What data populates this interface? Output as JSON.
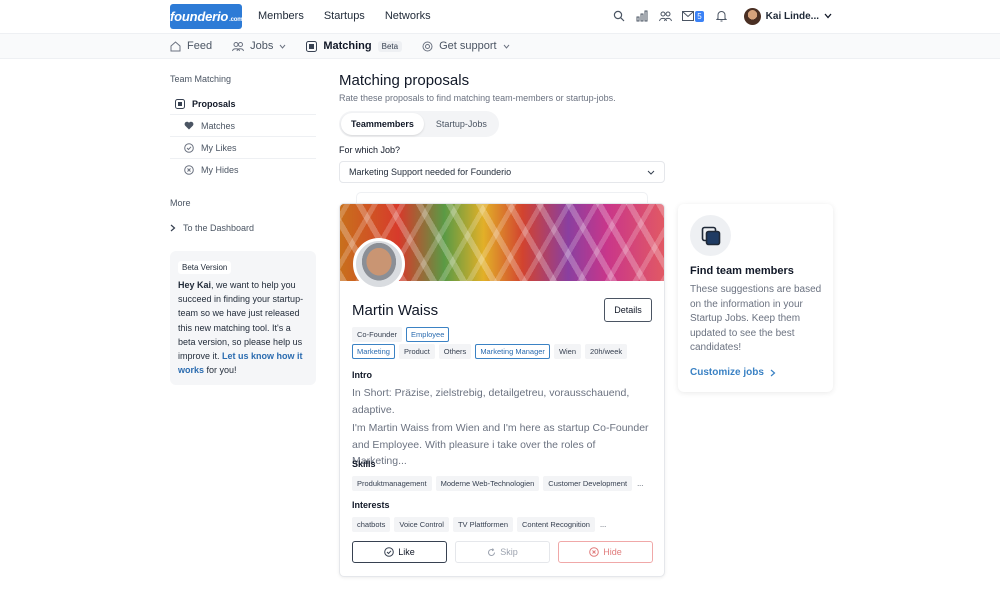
{
  "header": {
    "logo": "founderio",
    "logo_suffix": ".com",
    "nav": [
      "Members",
      "Startups",
      "Networks"
    ],
    "mail_count": "5",
    "user_name": "Kai Linde..."
  },
  "subnav": {
    "feed": "Feed",
    "jobs": "Jobs",
    "matching": "Matching",
    "beta": "Beta",
    "support": "Get support"
  },
  "sidebar": {
    "heading": "Team Matching",
    "items": [
      {
        "label": "Proposals",
        "icon": "proposals-icon"
      },
      {
        "label": "Matches",
        "icon": "heart-icon"
      },
      {
        "label": "My Likes",
        "icon": "check-circle-icon"
      },
      {
        "label": "My Hides",
        "icon": "x-circle-icon"
      }
    ],
    "more_heading": "More",
    "dashboard": "To the Dashboard",
    "beta_box": {
      "badge": "Beta Version",
      "greeting": "Hey Kai",
      "text": ", we want to help you succeed in finding your startup-team so we have just released this new matching tool. It's a beta version, so please help us improve it. ",
      "link": "Let us know how it works",
      "tail": " for you!"
    }
  },
  "main": {
    "title": "Matching proposals",
    "subtitle": "Rate these proposals to find matching team-members or startup-jobs.",
    "tabs": [
      "Teammembers",
      "Startup-Jobs"
    ],
    "question": "For which Job?",
    "selected_job": "Marketing Support needed for Founderio"
  },
  "card": {
    "name": "Martin Waiss",
    "details": "Details",
    "roles": [
      {
        "label": "Co-Founder",
        "highlight": false
      },
      {
        "label": "Employee",
        "highlight": true
      }
    ],
    "tags": [
      {
        "label": "Marketing",
        "highlight": true
      },
      {
        "label": "Product",
        "highlight": false
      },
      {
        "label": "Others",
        "highlight": false
      },
      {
        "label": "Marketing Manager",
        "highlight": true
      },
      {
        "label": "Wien",
        "highlight": false
      },
      {
        "label": "20h/week",
        "highlight": false
      }
    ],
    "intro_heading": "Intro",
    "intro_1": "In Short: Präzise, zielstrebig, detailgetreu, vorausschauend, adaptive.",
    "intro_2": "I'm Martin Waiss from Wien and I'm here as startup Co-Founder and Employee. With pleasure i take over the roles of Marketing...",
    "skills_heading": "Skills",
    "skills": [
      "Produktmanagement",
      "Moderne Web-Technologien",
      "Customer Development"
    ],
    "interests_heading": "Interests",
    "interests": [
      "chatbots",
      "Voice Control",
      "TV Plattformen",
      "Content Recognition"
    ],
    "ellipsis": "...",
    "like": "Like",
    "skip": "Skip",
    "hide": "Hide"
  },
  "info": {
    "title": "Find team members",
    "text": "These suggestions are based on the information in your Startup Jobs. Keep them updated to see the best candidates!",
    "link": "Customize jobs"
  }
}
